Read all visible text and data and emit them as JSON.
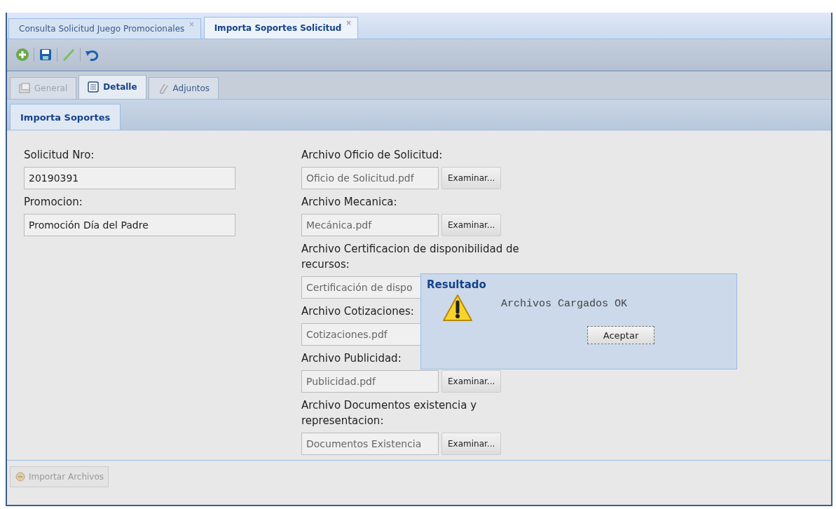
{
  "tabs": [
    {
      "label": "Consulta Solicitud Juego Promocionales",
      "selected": false,
      "close": "×"
    },
    {
      "label": "Importa Soportes Solicitud",
      "selected": true,
      "close": "×"
    }
  ],
  "subtabs": [
    {
      "label": "General",
      "selected": false,
      "disabled": true
    },
    {
      "label": "Detalle",
      "selected": true,
      "disabled": false
    },
    {
      "label": "Adjuntos",
      "selected": false,
      "disabled": false
    }
  ],
  "panel_tab": {
    "label": "Importa Soportes",
    "selected": true
  },
  "left_fields": [
    {
      "label": "Solicitud Nro:",
      "value": "20190391"
    },
    {
      "label": "Promocion:",
      "value": "Promoción Día del Padre"
    }
  ],
  "file_fields": [
    {
      "label": "Archivo Oficio de Solicitud:",
      "value": "Oficio de Solicitud.pdf",
      "button": "Examinar..."
    },
    {
      "label": "Archivo Mecanica:",
      "value": "Mecánica.pdf",
      "button": "Examinar..."
    },
    {
      "label": "Archivo Certificacion de disponibilidad de recursos:",
      "value": "Certificación de dispo"
    },
    {
      "label": "Archivo Cotizaciones:",
      "value": "Cotizaciones.pdf"
    },
    {
      "label": "Archivo Publicidad:",
      "value": "Publicidad.pdf",
      "button": "Examinar..."
    },
    {
      "label": "Archivo Documentos existencia y representacion:",
      "value": "Documentos Existencia",
      "button": "Examinar..."
    }
  ],
  "footer_button": {
    "label": "Importar Archivos",
    "disabled": true
  },
  "dialog": {
    "title": "Resultado",
    "message": "Archivos Cargados OK",
    "button": "Aceptar"
  }
}
